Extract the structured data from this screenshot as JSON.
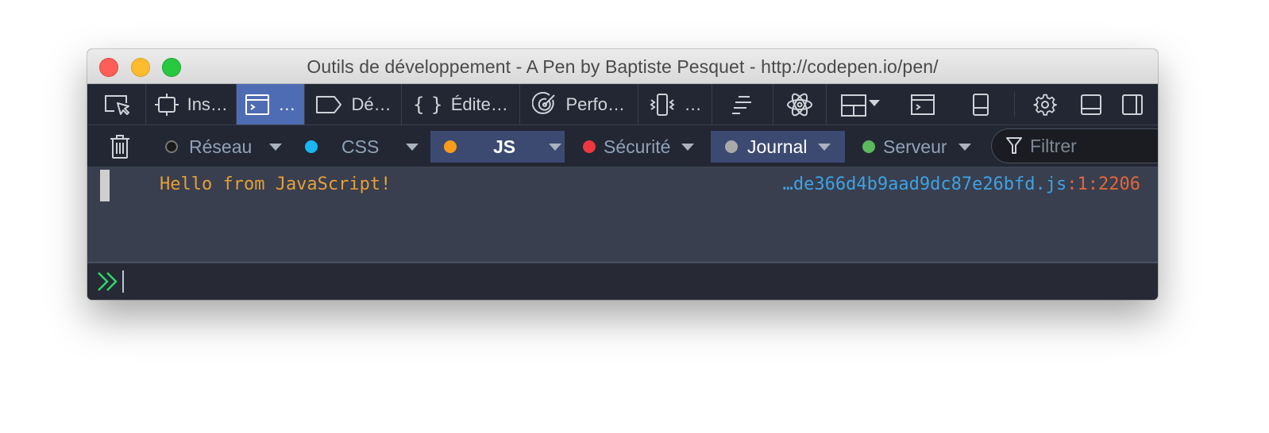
{
  "window": {
    "title": "Outils de développement - A Pen by Baptiste Pesquet - http://codepen.io/pen/"
  },
  "toolbar": {
    "tools": [
      {
        "icon": "element-picker-icon",
        "label": ""
      },
      {
        "icon": "inspector-icon",
        "label": "Ins…"
      },
      {
        "icon": "console-icon",
        "label": "…",
        "active": true
      },
      {
        "icon": "debugger-icon",
        "label": "Dé…"
      },
      {
        "icon": "style-editor-icon",
        "label": "Édite…"
      },
      {
        "icon": "performance-icon",
        "label": "Perfo…"
      },
      {
        "icon": "responsive-icon",
        "label": "…"
      },
      {
        "icon": "waterfall-icon",
        "label": ""
      },
      {
        "icon": "react-icon",
        "label": ""
      }
    ],
    "right_icons": [
      "layout-dropdown-icon",
      "split-console-icon",
      "dock-side-icon",
      "settings-gear-icon",
      "dock-bottom-icon",
      "dock-right-icon"
    ]
  },
  "filters": {
    "trash_icon": "clear-console-icon",
    "items": [
      {
        "label": "Réseau",
        "dot_color": "#1b1b1b",
        "active": false
      },
      {
        "label": "CSS",
        "dot_color": "#1ab6f0",
        "active": false
      },
      {
        "label": "JS",
        "dot_color": "#f79b1a",
        "active": true
      },
      {
        "label": "Sécurité",
        "dot_color": "#ee3740",
        "active": false
      },
      {
        "label": "Journal",
        "dot_color": "#a9a9a9",
        "active": true
      },
      {
        "label": "Serveur",
        "dot_color": "#5cb85c",
        "active": false
      }
    ],
    "search_placeholder": "Filtrer"
  },
  "console": {
    "messages": [
      {
        "text": "Hello from JavaScript!",
        "file": "…de366d4b9aad9dc87e26bfd.js",
        "location": ":1:2206"
      }
    ],
    "prompt": "»"
  },
  "colors": {
    "accent": "#4e6cb3",
    "filter_active": "#3c4a71",
    "log_text": "#e59f3a",
    "file_link": "#3ea2e4",
    "line_number": "#e3663a",
    "prompt": "#2bd86f"
  }
}
